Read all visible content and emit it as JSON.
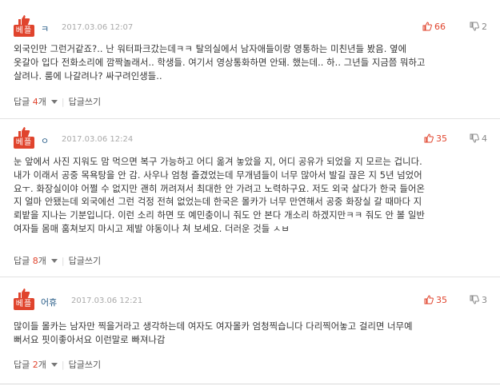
{
  "labels": {
    "best": "베플",
    "reply": "답글",
    "reply_suffix": "개",
    "write_reply": "답글쓰기"
  },
  "colors": {
    "accent": "#e0442d",
    "author": "#2b5f8a",
    "muted": "#aaaaaa"
  },
  "comments": [
    {
      "author": "ㅋ",
      "date": "2017.03.06 12:07",
      "up": "66",
      "down": "2",
      "lines": [
        "외국인만 그런거같죠?.. 난 워터파크갔는데ㅋㅋ 탈의실에서 남자애들이랑 영통하는 미친년들 봤음. 옆에",
        "옷갈아 입다 전화소리에 깜짝놀래서.. 학생들. 여기서 영상통화하면 안돼. 했는데.. 하.. 그년들 지금쯤 뭐하고",
        "살려나. 룸에 나갈려나? 싸구려인생들.."
      ],
      "reply_count": "4"
    },
    {
      "author": "ㅇ",
      "date": "2017.03.06 12:24",
      "up": "35",
      "down": "4",
      "lines": [
        "눈 앞에서 사진 지워도 맘 먹으면 복구 가능하고 어디 옮겨 놓았을 지, 어디 공유가 되었을 지 모르는 겁니다.",
        "내가 이래서 공중 목욕탕을 안 감. 사우나 엄청 즐겼었는데 무개념들이 너무 많아서 발길 끊은 지 5년 넘었어",
        "요ㅜ. 화장실이야 어쩔 수 없지만 괜히 꺼려져서 최대한 안 가려고 노력하구요. 저도 외국 살다가 한국 들어온",
        "지 얼마 안됐는데 외국에선 그런 걱정 전혀 없었는데 한국은 몰카가 너무 만연해서 공중 화장실 갈 때마다 지",
        "뢰밭을 지나는 기분입니다. 이런 소리 하면 또 예민충이니 줘도 안 본다 개소리 하겠지만ㅋㅋ 줘도 안 볼 일반",
        "여자들 몸매 훔쳐보지 마시고 제발 야동이나 쳐 보세요. 더러운 것들 ㅅㅂ"
      ],
      "reply_count": "8"
    },
    {
      "author": "어휴",
      "date": "2017.03.06 12:21",
      "up": "35",
      "down": "3",
      "lines": [
        "많이들 몰카는 남자만 찍을거라고 생각하는데 여자도 여자몰카 엄청찍습니다 다리찍어놓고 걸리면 너무예",
        "뻐서요 핏이좋아서요 이런말로 빠져나감"
      ],
      "reply_count": "2"
    }
  ]
}
